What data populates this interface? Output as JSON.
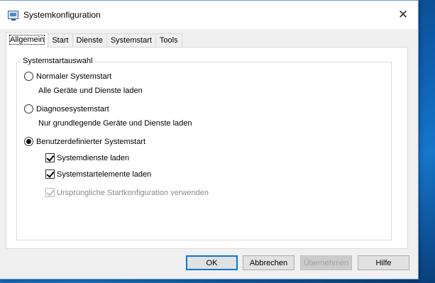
{
  "window": {
    "title": "Systemkonfiguration",
    "close_glyph": "✕"
  },
  "tabs": [
    {
      "label": "Allgemein",
      "active": true
    },
    {
      "label": "Start",
      "active": false
    },
    {
      "label": "Dienste",
      "active": false
    },
    {
      "label": "Systemstart",
      "active": false
    },
    {
      "label": "Tools",
      "active": false
    }
  ],
  "group": {
    "title": "Systemstartauswahl",
    "options": [
      {
        "label": "Normaler Systemstart",
        "description": "Alle Geräte und Dienste laden",
        "selected": false
      },
      {
        "label": "Diagnosesystemstart",
        "description": "Nur grundlegende Geräte und Dienste laden",
        "selected": false
      },
      {
        "label": "Benutzerdefinierter Systemstart",
        "selected": true
      }
    ],
    "checkboxes": [
      {
        "label": "Systemdienste laden",
        "checked": true,
        "enabled": true
      },
      {
        "label": "Systemstartelemente laden",
        "checked": true,
        "enabled": true
      },
      {
        "label": "Ursprüngliche Startkonfiguration verwenden",
        "checked": true,
        "enabled": false
      }
    ]
  },
  "buttons": {
    "ok": "OK",
    "cancel": "Abbrechen",
    "apply": "Übernehmen",
    "help": "Hilfe"
  },
  "colors": {
    "accent": "#0078d7",
    "window_bg": "#f0f0f0"
  }
}
